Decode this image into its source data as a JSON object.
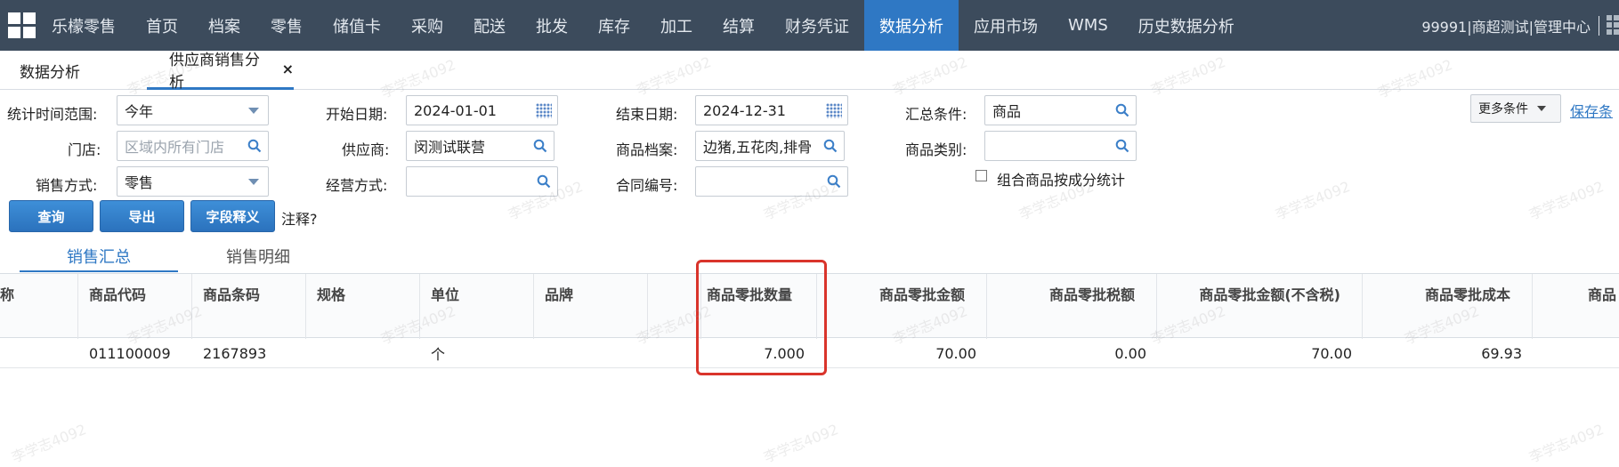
{
  "nav": {
    "brand": "乐檬零售",
    "items": [
      "首页",
      "档案",
      "零售",
      "储值卡",
      "采购",
      "配送",
      "批发",
      "库存",
      "加工",
      "结算",
      "财务凭证",
      "数据分析",
      "应用市场",
      "WMS",
      "历史数据分析"
    ],
    "active": "数据分析",
    "user": "99991|商超测试|管理中心"
  },
  "tabs": {
    "home": "数据分析",
    "current": "供应商销售分析",
    "close": "×"
  },
  "form": {
    "range_label": "统计时间范围:",
    "range_value": "今年",
    "start_label": "开始日期:",
    "start_value": "2024-01-01",
    "end_label": "结束日期:",
    "end_value": "2024-12-31",
    "summary_label": "汇总条件:",
    "summary_value": "商品",
    "store_label": "门店:",
    "store_placeholder": "区域内所有门店",
    "supplier_label": "供应商:",
    "supplier_value": "闵测试联营",
    "goods_label": "商品档案:",
    "goods_value": "边猪,五花肉,排骨",
    "category_label": "商品类别:",
    "category_value": "",
    "sale_mode_label": "销售方式:",
    "sale_mode_value": "零售",
    "biz_mode_label": "经营方式:",
    "biz_mode_value": "",
    "contract_label": "合同编号:",
    "contract_value": "",
    "combo_label": "组合商品按成分统计",
    "more_label": "更多条件",
    "save_label": "保存条"
  },
  "buttons": {
    "query": "查询",
    "export": "导出",
    "field_help": "字段释义",
    "note": "注释?"
  },
  "subtabs": [
    "销售汇总",
    "销售明细"
  ],
  "table": {
    "columns": [
      "称",
      "商品代码",
      "商品条码",
      "规格",
      "单位",
      "品牌",
      "",
      "商品零批数量",
      "商品零批金额",
      "商品零批税额",
      "商品零批金额(不含税)",
      "商品零批成本",
      "商品"
    ],
    "rows": [
      [
        "",
        "011100009",
        "2167893",
        "",
        "个",
        "",
        "",
        "7.000",
        "70.00",
        "0.00",
        "70.00",
        "69.93",
        ""
      ]
    ]
  },
  "watermark": "李学志4092",
  "colors": {
    "nav_bg": "#3c4b5c",
    "accent": "#2f78c4",
    "highlight": "#d9342b"
  }
}
